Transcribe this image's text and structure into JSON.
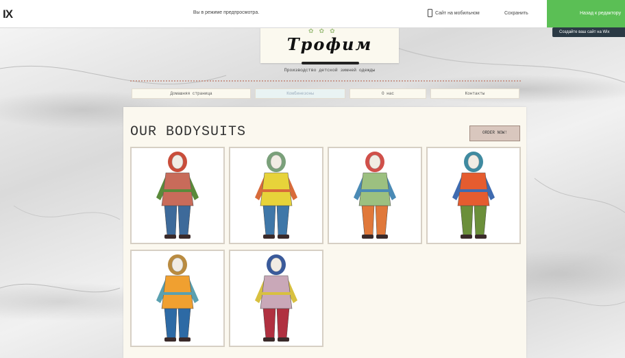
{
  "editor_bar": {
    "logo": "IX",
    "preview_message": "Вы в режиме предпросмотра.",
    "mobile_label": "Сайт на мобильном",
    "save_label": "Сохранить",
    "edit_label": "Назад к редактору",
    "tooltip": "Создайте ваш сайт на Wix"
  },
  "site": {
    "logo_text": "Трофим",
    "tagline": "Производство детской зимней одежды",
    "nav": [
      {
        "label": "Домашняя страница"
      },
      {
        "label": "Комбинезоны"
      },
      {
        "label": "О нас"
      },
      {
        "label": "Контакты"
      }
    ],
    "section_title": "OUR BODYSUITS",
    "order_button": "ORDER NOW!",
    "products": [
      {
        "name": "product-1",
        "hood": "#c94d3a",
        "jacket": "#c86b5a",
        "pants": "#3d6a9a",
        "accent": "#5a8a3a"
      },
      {
        "name": "product-2",
        "hood": "#7aa07a",
        "jacket": "#e7d33a",
        "pants": "#3f77a8",
        "accent": "#d86b3a"
      },
      {
        "name": "product-3",
        "hood": "#d0504a",
        "jacket": "#9cc080",
        "pants": "#e0783a",
        "accent": "#4a8ab5"
      },
      {
        "name": "product-4",
        "hood": "#3f8aa0",
        "jacket": "#e55c2f",
        "pants": "#6b8f3a",
        "accent": "#3f6bb0"
      },
      {
        "name": "product-5",
        "hood": "#b98b40",
        "jacket": "#f0a030",
        "pants": "#2d6aa5",
        "accent": "#5aa0b0"
      },
      {
        "name": "product-6",
        "hood": "#3a5a9a",
        "jacket": "#c9a8b8",
        "pants": "#b03040",
        "accent": "#d8c040"
      }
    ]
  }
}
